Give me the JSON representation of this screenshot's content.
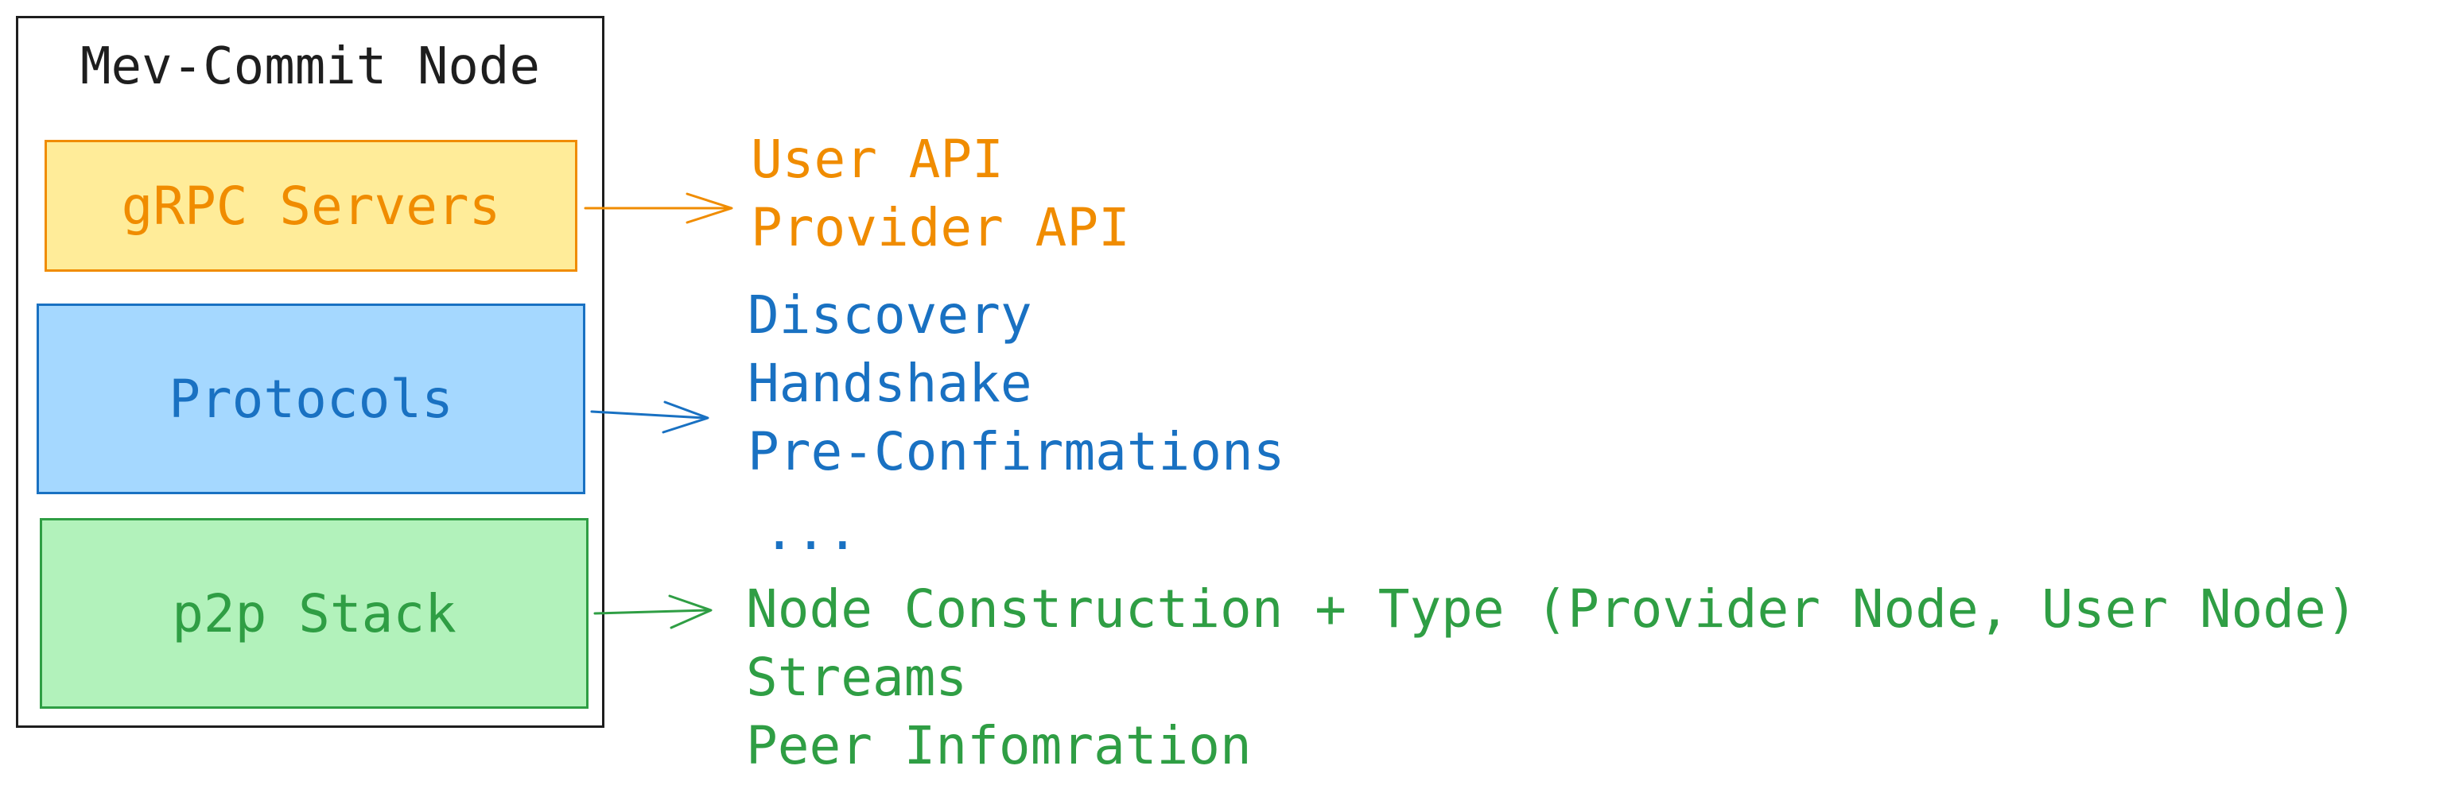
{
  "diagram": {
    "node_title": "Mev-Commit Node",
    "layers": {
      "grpc": {
        "label": "gRPC Servers",
        "color": "#f08c00",
        "fill": "#ffec99"
      },
      "protocols": {
        "label": "Protocols",
        "color": "#1971c2",
        "fill": "#a5d8ff"
      },
      "p2p": {
        "label": "p2p Stack",
        "color": "#2f9e44",
        "fill": "#b2f2bb"
      }
    },
    "grpc_items": [
      "User API",
      "Provider API"
    ],
    "protocol_items": [
      "Discovery",
      "Handshake",
      "Pre-Confirmations"
    ],
    "protocol_more": "...",
    "p2p_items": [
      "Node Construction + Type (Provider Node, User Node)",
      "Streams",
      "Peer Infomration"
    ]
  }
}
